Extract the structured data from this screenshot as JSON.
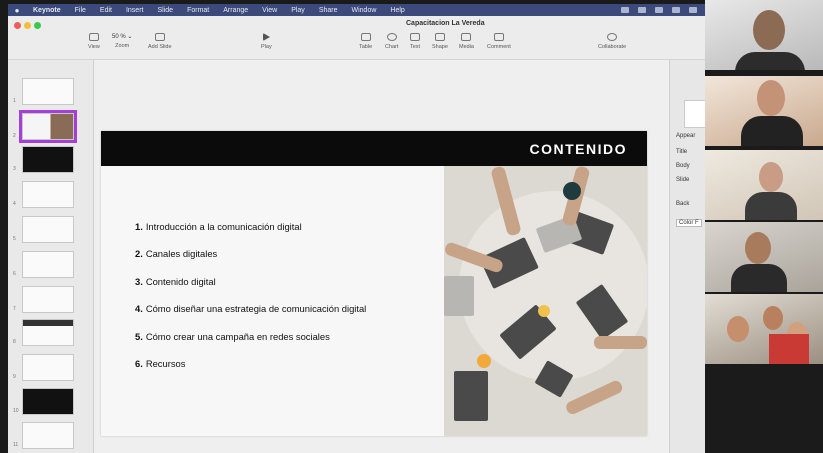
{
  "menubar": {
    "items": [
      "Keynote",
      "File",
      "Edit",
      "Insert",
      "Slide",
      "Format",
      "Arrange",
      "View",
      "Play",
      "Share",
      "Window",
      "Help"
    ]
  },
  "window": {
    "title": "Capacitacion La Vereda"
  },
  "toolbar": {
    "view": "View",
    "zoom_value": "50 % ⌄",
    "zoom": "Zoom",
    "add_slide": "Add Slide",
    "play": "Play",
    "table": "Table",
    "chart": "Chart",
    "text": "Text",
    "shape": "Shape",
    "media": "Media",
    "comment": "Comment",
    "collaborate": "Collaborate"
  },
  "navigator": {
    "numbers": [
      "1",
      "2",
      "3",
      "4",
      "5",
      "6",
      "7",
      "8",
      "9",
      "10",
      "11"
    ],
    "selected_index": 1
  },
  "slide": {
    "title": "CONTENIDO",
    "items": [
      {
        "num": "1.",
        "text": "Introducción a la comunicación digital"
      },
      {
        "num": "2.",
        "text": "Canales digitales"
      },
      {
        "num": "3.",
        "text": "Contenido digital"
      },
      {
        "num": "4.",
        "text": "Cómo diseñar una estrategia de comunicación digital"
      },
      {
        "num": "5.",
        "text": "Cómo crear una campaña en redes sociales"
      },
      {
        "num": "6.",
        "text": "Recursos"
      }
    ]
  },
  "inspector": {
    "appear": "Appear",
    "title": "Title",
    "body": "Body",
    "slide": "Slide",
    "background": "Back",
    "color": "Color F"
  },
  "colors": {
    "menubar": "#3b4a7a",
    "slide_header": "#0b0b0b",
    "selection": "#a63fd9"
  }
}
